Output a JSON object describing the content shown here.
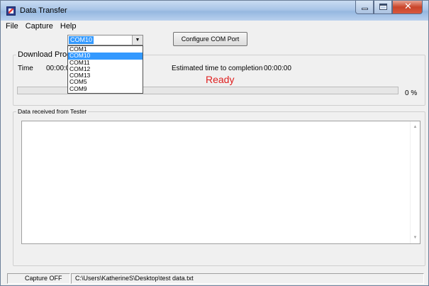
{
  "window": {
    "title": "Data Transfer",
    "colors": {
      "selection": "#3399ff",
      "ready": "#e02020",
      "close_button": "#c9452a"
    }
  },
  "menu": {
    "items": [
      "File",
      "Capture",
      "Help"
    ]
  },
  "port": {
    "selected": "COM10",
    "options": [
      "COM1",
      "COM10",
      "COM11",
      "COM12",
      "COM13",
      "COM5",
      "COM9"
    ],
    "highlighted_index": 1
  },
  "configure_button": {
    "label": "Configure COM Port"
  },
  "download": {
    "group_title": "Download Progress",
    "time_label": "Time",
    "time_value": "00:00:00",
    "eta_label": "Estimated time to completion",
    "eta_value": "00:00:00",
    "status": "Ready",
    "progress_percent": 0,
    "percent_label": "0 %"
  },
  "data_group": {
    "title": "Data received from Tester",
    "content": ""
  },
  "status_bar": {
    "capture": "Capture OFF",
    "path": "C:\\Users\\KatherineS\\Desktop\\test data.txt"
  }
}
